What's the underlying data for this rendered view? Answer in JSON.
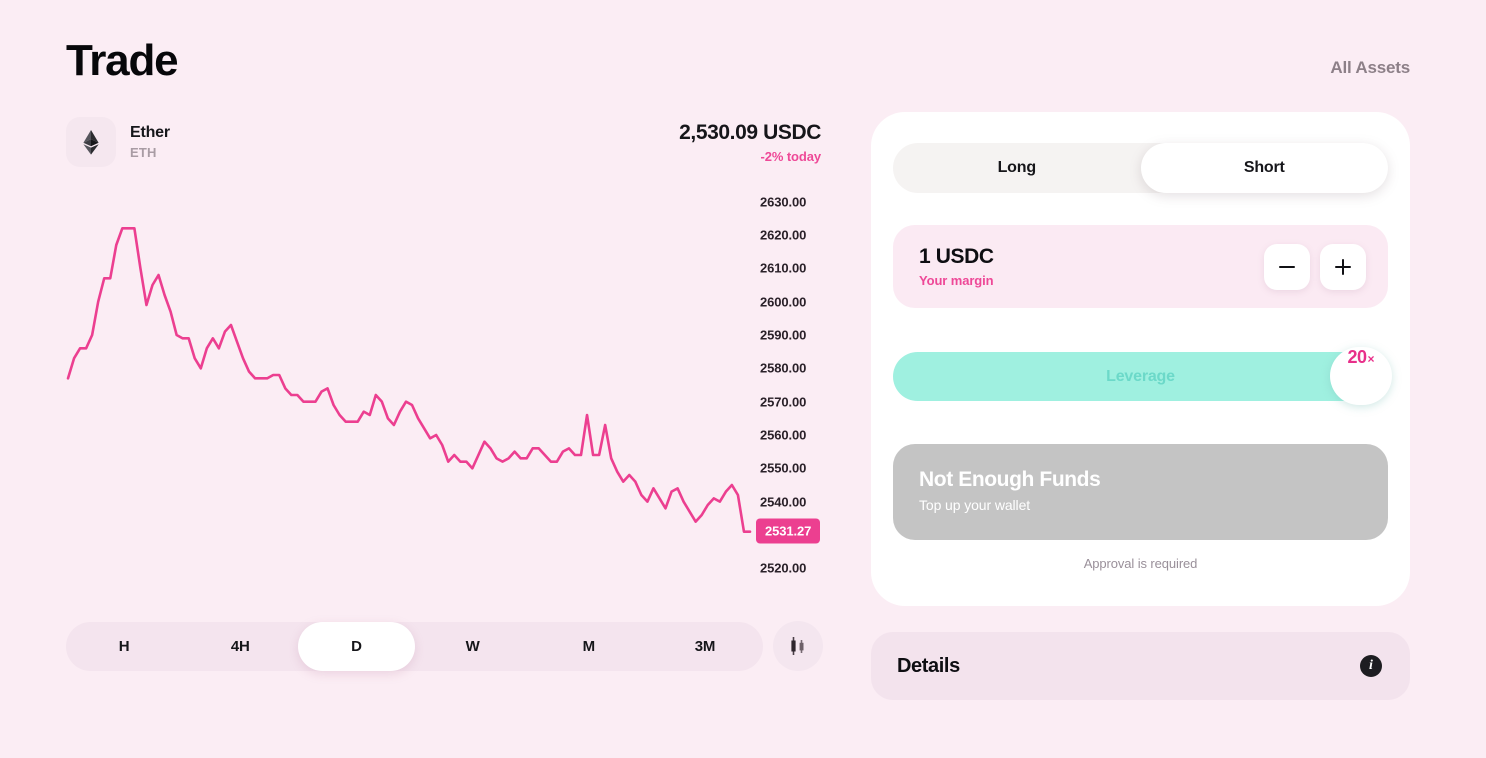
{
  "header": {
    "title": "Trade",
    "all_assets_label": "All Assets"
  },
  "asset": {
    "icon": "ethereum-icon",
    "name": "Ether",
    "ticker": "ETH",
    "price": "2,530.09 USDC",
    "change": "-2% today"
  },
  "chart_data": {
    "type": "line",
    "title": "",
    "xlabel": "",
    "ylabel": "",
    "ylim": [
      2515,
      2635
    ],
    "grid": false,
    "legend": "none",
    "line_color": "#ec3f90",
    "current_price": 2531.27,
    "current_price_label": "2531.27",
    "tick_labels": [
      "2630.00",
      "2620.00",
      "2610.00",
      "2600.00",
      "2590.00",
      "2580.00",
      "2570.00",
      "2560.00",
      "2550.00",
      "2540.00",
      "2520.00"
    ],
    "tick_values": [
      2630,
      2620,
      2610,
      2600,
      2590,
      2580,
      2570,
      2560,
      2550,
      2540,
      2520
    ],
    "values": [
      2577,
      2583,
      2586,
      2586,
      2590,
      2600,
      2607,
      2607,
      2617,
      2622,
      2622,
      2622,
      2610,
      2599,
      2605,
      2608,
      2602,
      2597,
      2590,
      2589,
      2589,
      2583,
      2580,
      2586,
      2589,
      2586,
      2591,
      2593,
      2588,
      2583,
      2579,
      2577,
      2577,
      2577,
      2578,
      2578,
      2574,
      2572,
      2572,
      2570,
      2570,
      2570,
      2573,
      2574,
      2569,
      2566,
      2564,
      2564,
      2564,
      2567,
      2566,
      2572,
      2570,
      2565,
      2563,
      2567,
      2570,
      2569,
      2565,
      2562,
      2559,
      2560,
      2557,
      2552,
      2554,
      2552,
      2552,
      2550,
      2554,
      2558,
      2556,
      2553,
      2552,
      2553,
      2555,
      2553,
      2553,
      2556,
      2556,
      2554,
      2552,
      2552,
      2555,
      2556,
      2554,
      2554,
      2566,
      2554,
      2554,
      2563,
      2553,
      2549,
      2546,
      2548,
      2546,
      2542,
      2540,
      2544,
      2541,
      2538,
      2543,
      2544,
      2540,
      2537,
      2534,
      2536,
      2539,
      2541,
      2540,
      2543,
      2545,
      2542,
      2531,
      2531
    ]
  },
  "timeframes": {
    "options": [
      "H",
      "4H",
      "D",
      "W",
      "M",
      "3M"
    ],
    "selected": "D",
    "chart_type_toggle_icon": "candlestick-icon"
  },
  "trade": {
    "direction": {
      "options": [
        "Long",
        "Short"
      ],
      "selected": "Short"
    },
    "margin": {
      "value": "1 USDC",
      "label": "Your margin",
      "decrease_icon": "minus-icon",
      "increase_icon": "plus-icon"
    },
    "leverage": {
      "label": "Leverage",
      "value": "20",
      "unit": "×",
      "track_color": "#9ff0e0",
      "accent_color": "#e8308a"
    },
    "action": {
      "title": "Not Enough Funds",
      "subtitle": "Top up your wallet",
      "disabled_color": "#c4c4c4"
    },
    "approval_note": "Approval is required"
  },
  "details": {
    "title": "Details",
    "info_icon": "info-icon"
  }
}
